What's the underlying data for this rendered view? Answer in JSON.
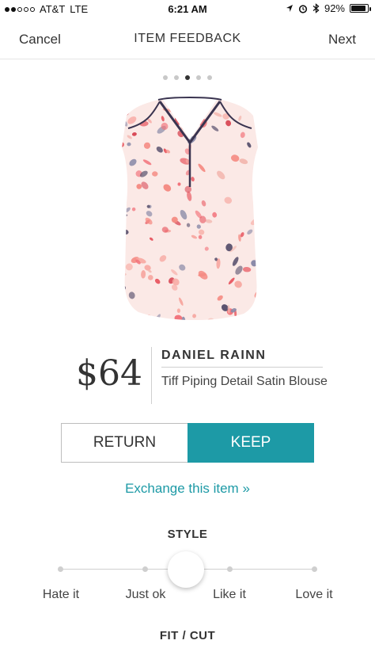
{
  "status_bar": {
    "carrier": "AT&T",
    "network": "LTE",
    "time": "6:21 AM",
    "battery": "92%",
    "battery_level": 0.92,
    "signal_bars_filled": 2,
    "signal_bars_total": 5,
    "icons": [
      "location-arrow-icon",
      "alarm-clock-icon",
      "bluetooth-icon",
      "battery-icon"
    ]
  },
  "nav": {
    "left": "Cancel",
    "title": "ITEM FEEDBACK",
    "right": "Next"
  },
  "pager": {
    "count": 5,
    "active_index": 2
  },
  "product": {
    "price": "$64",
    "brand": "DANIEL RAINN",
    "name": "Tiff Piping Detail Satin Blouse",
    "image_icon": "blouse-product-image"
  },
  "decision": {
    "return_label": "RETURN",
    "keep_label": "KEEP",
    "selected": "KEEP"
  },
  "exchange_link": "Exchange this item »",
  "style_rating": {
    "title": "STYLE",
    "options": [
      "Hate it",
      "Just ok",
      "Like it",
      "Love it"
    ],
    "selected_position": 0.5
  },
  "fit_section": {
    "title": "FIT / CUT"
  },
  "colors": {
    "accent": "#1d9aa6",
    "text": "#333333",
    "divider": "#cfcfcf"
  }
}
